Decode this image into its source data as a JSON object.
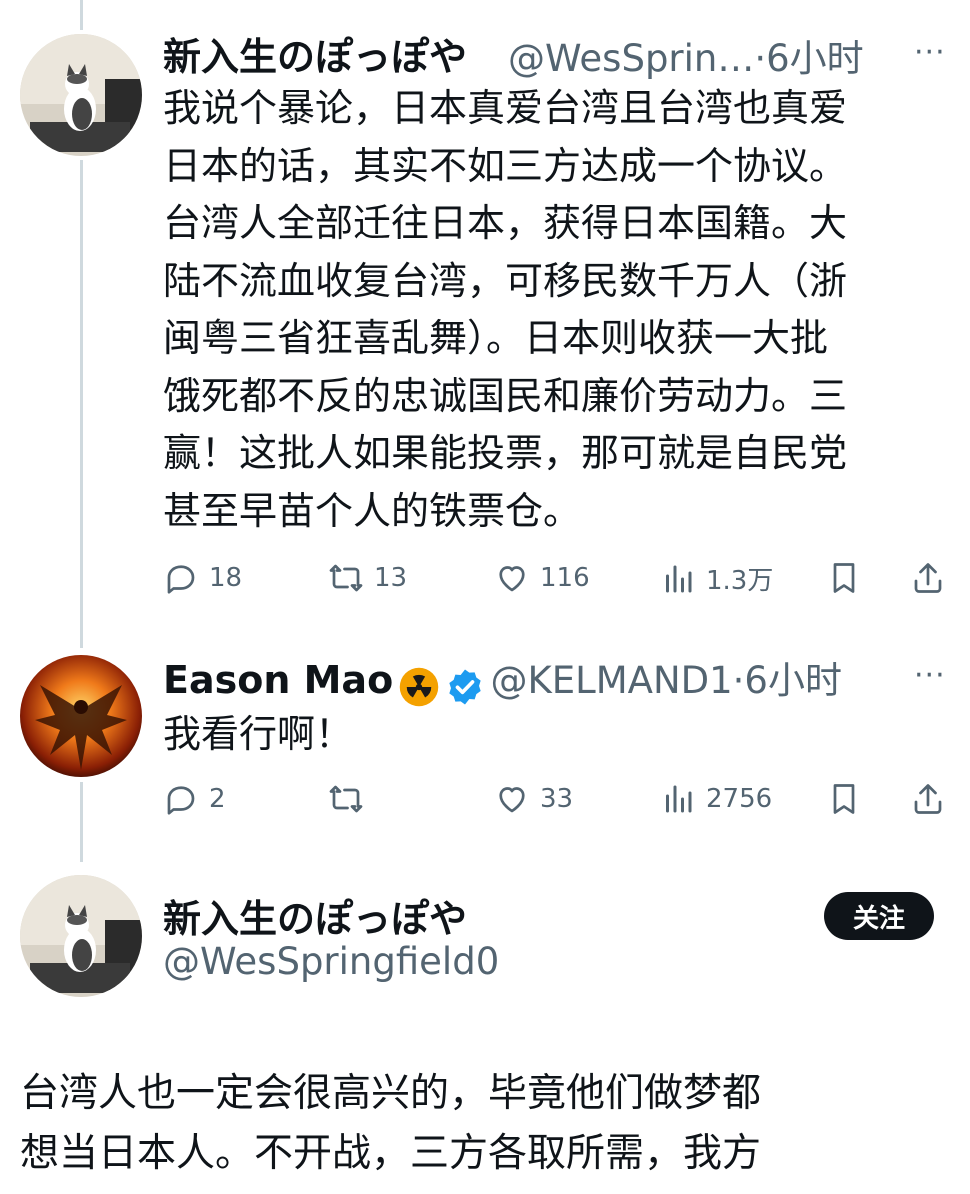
{
  "tweet1": {
    "name": "新入生のぽっぽや",
    "handle": "@WesSprin…",
    "time": "·6小时",
    "more": "···",
    "lines": [
      "我说个暴论，日本真爱台湾且台湾也真爱",
      "日本的话，其实不如三方达成一个协议。",
      "台湾人全部迁往日本，获得日本国籍。大",
      "陆不流血收复台湾，可移民数千万人（浙",
      "闽粤三省狂喜乱舞）。日本则收获一大批",
      "饿死都不反的忠诚国民和廉价劳动力。三",
      "赢！这批人如果能投票，那可就是自民党",
      "甚至早苗个人的铁票仓。"
    ],
    "replies": "18",
    "retweets": "13",
    "likes": "116",
    "views": "1.3万"
  },
  "tweet2": {
    "name": "Eason Mao",
    "handle": "@KELMAND1",
    "time": "·6小时",
    "more": "···",
    "text": "我看行啊！",
    "replies": "2",
    "retweets": "",
    "likes": "33",
    "views": "2756"
  },
  "tweet3": {
    "name": "新入生のぽっぽや",
    "handle": "@WesSpringfield0",
    "follow_label": "关注",
    "lines": [
      "台湾人也一定会很高兴的，毕竟他们做梦都",
      "想当日本人。不开战，三方各取所需，我方"
    ]
  },
  "colors": {
    "text": "#0f1419",
    "secondary": "#536471",
    "verified": "#1d9bf0",
    "nuclear": "#f4a100"
  }
}
